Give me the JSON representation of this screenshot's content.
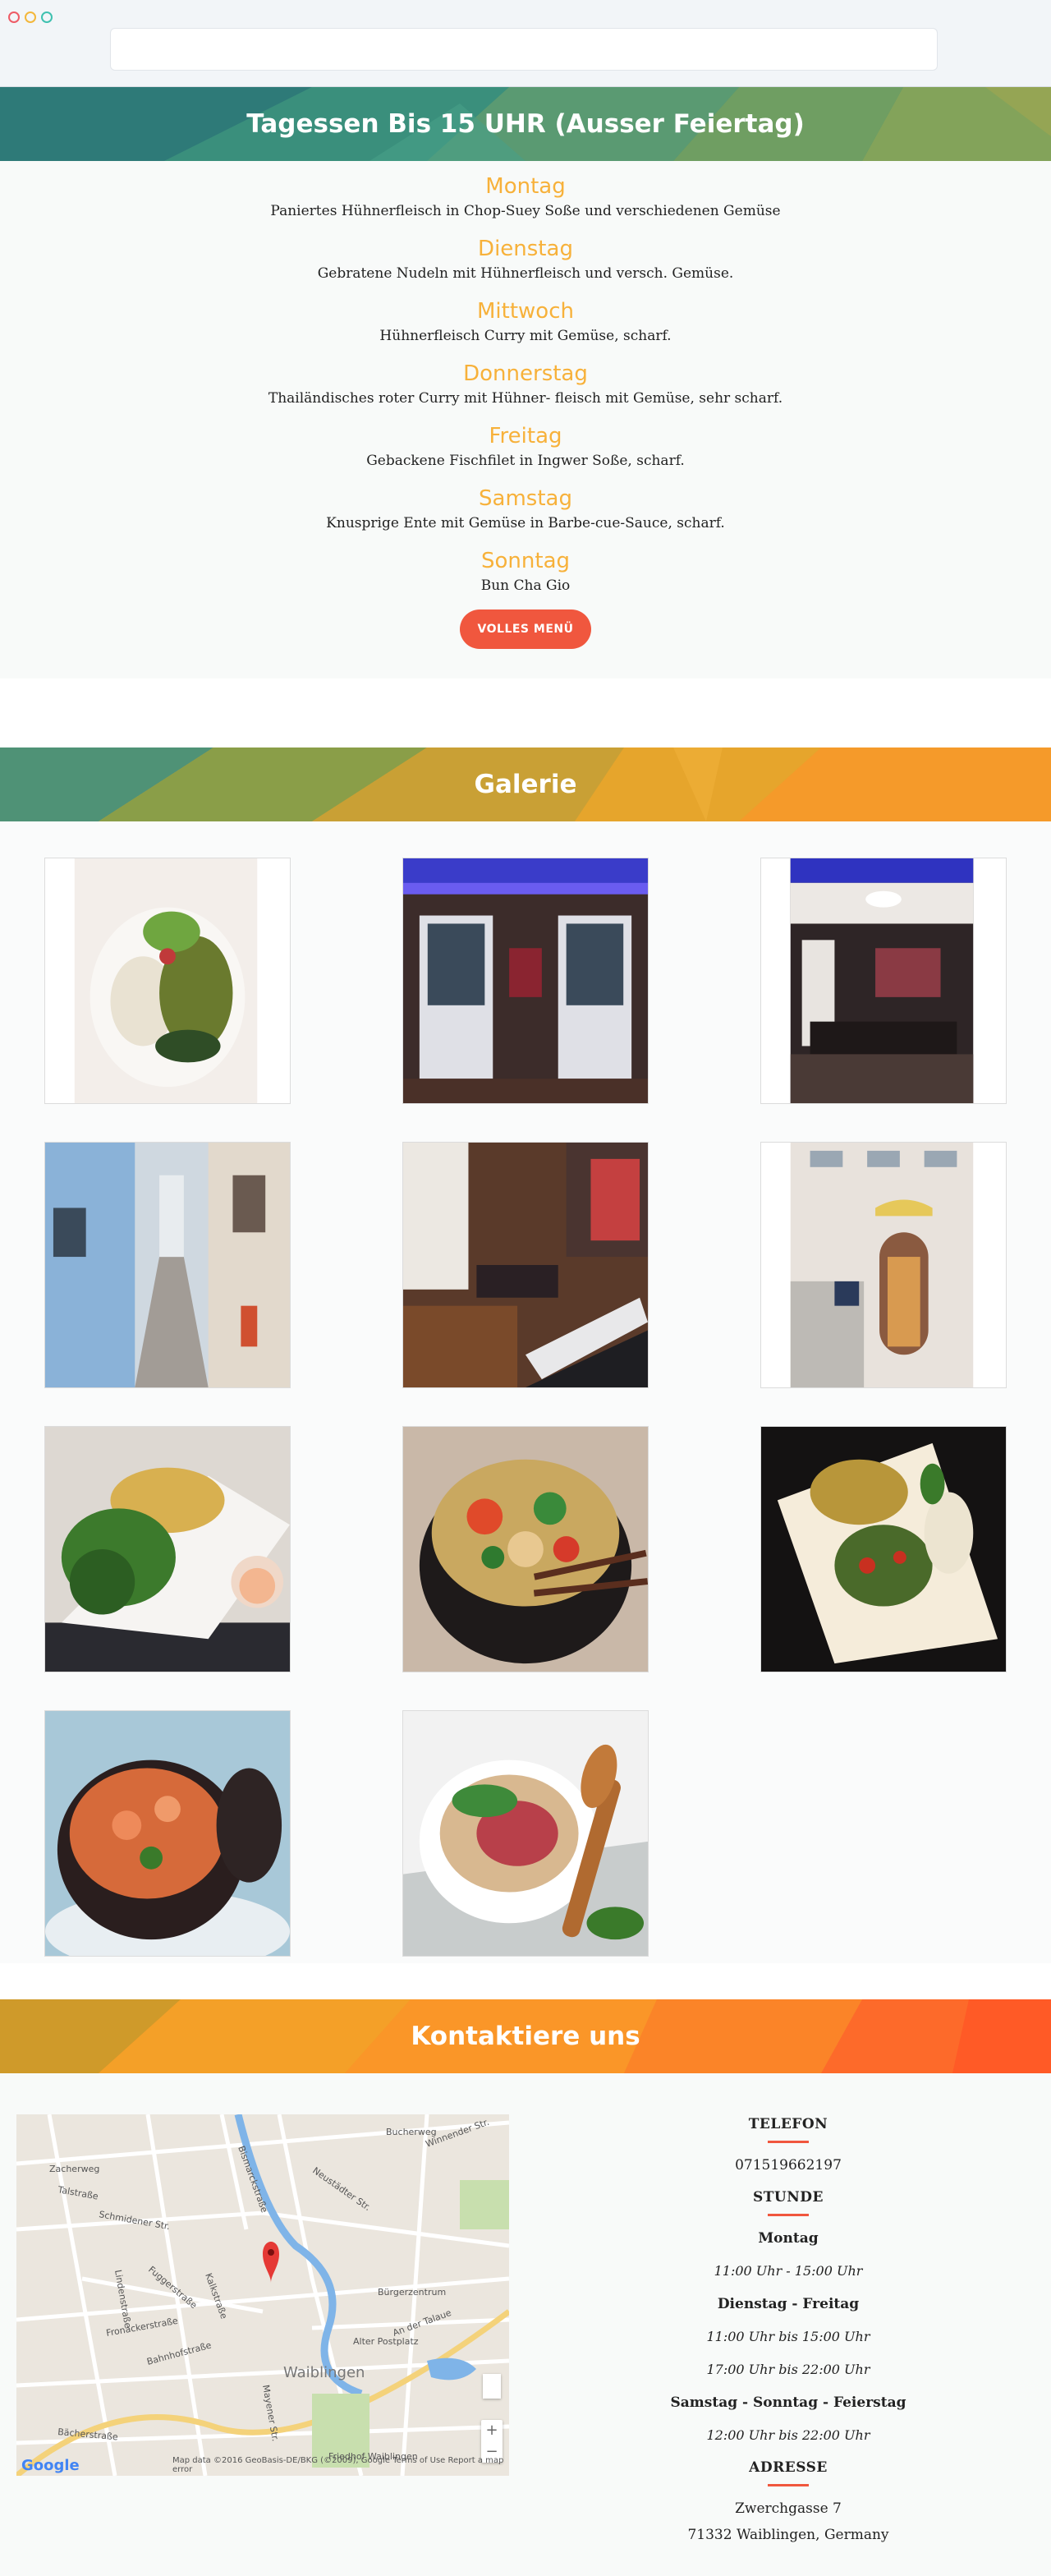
{
  "menu_section": {
    "title": "Tagessen Bis 15 UHR (Ausser Feiertag)",
    "days": [
      {
        "day": "Montag",
        "dish": "Paniertes Hühnerfleisch in Chop-Suey Soße und verschiedenen Gemüse"
      },
      {
        "day": "Dienstag",
        "dish": "Gebratene Nudeln mit Hühnerfleisch und versch. Gemüse."
      },
      {
        "day": "Mittwoch",
        "dish": "Hühnerfleisch Curry mit Gemüse, scharf."
      },
      {
        "day": "Donnerstag",
        "dish": "Thailändisches roter Curry mit Hühner- fleisch mit Gemüse, sehr scharf."
      },
      {
        "day": "Freitag",
        "dish": "Gebackene Fischfilet in Ingwer Soße, scharf."
      },
      {
        "day": "Samstag",
        "dish": "Knusprige Ente mit Gemüse in Barbe-cue-Sauce, scharf."
      },
      {
        "day": "Sonntag",
        "dish": "Bun Cha Gio"
      }
    ],
    "button_label": "VOLLES MENÜ"
  },
  "gallery": {
    "title": "Galerie"
  },
  "contact": {
    "title": "Kontaktiere uns",
    "phone_heading": "TELEFON",
    "phone": "071519662197",
    "hours_heading": "STUNDE",
    "hours": [
      {
        "label": "Montag",
        "times": [
          "11:00 Uhr - 15:00 Uhr"
        ]
      },
      {
        "label": "Dienstag - Freitag",
        "times": [
          "11:00 Uhr bis 15:00 Uhr",
          "17:00 Uhr bis 22:00 Uhr"
        ]
      },
      {
        "label": "Samstag - Sonntag - Feierstag",
        "times": [
          "12:00 Uhr bis 22:00 Uhr"
        ]
      }
    ],
    "address_heading": "ADRESSE",
    "address_line1": "Zwerchgasse 7",
    "address_line2": "71332 Waiblingen, Germany",
    "map": {
      "labels": [
        "Zacherweg",
        "Talstraße",
        "Schmidener Str.",
        "Kalkstraße",
        "Bürgerzentrum",
        "Waiblingen",
        "Bahnhofstraße",
        "Fuggerstraße",
        "Bismarckstraße",
        "Lindenstraße",
        "Neustädter Str.",
        "Winnender Str.",
        "Bucherweg",
        "Fronackerstraße",
        "Mayener Str.",
        "Bächerstraße",
        "Alter Postplatz",
        "An der Talaue",
        "Friedhof Waiblingen"
      ],
      "google": "Google",
      "footer": "Map data ©2016 GeoBasis-DE/BKG (©2009), Google   Terms of Use   Report a map error",
      "zoom_in": "+",
      "zoom_out": "−"
    }
  }
}
